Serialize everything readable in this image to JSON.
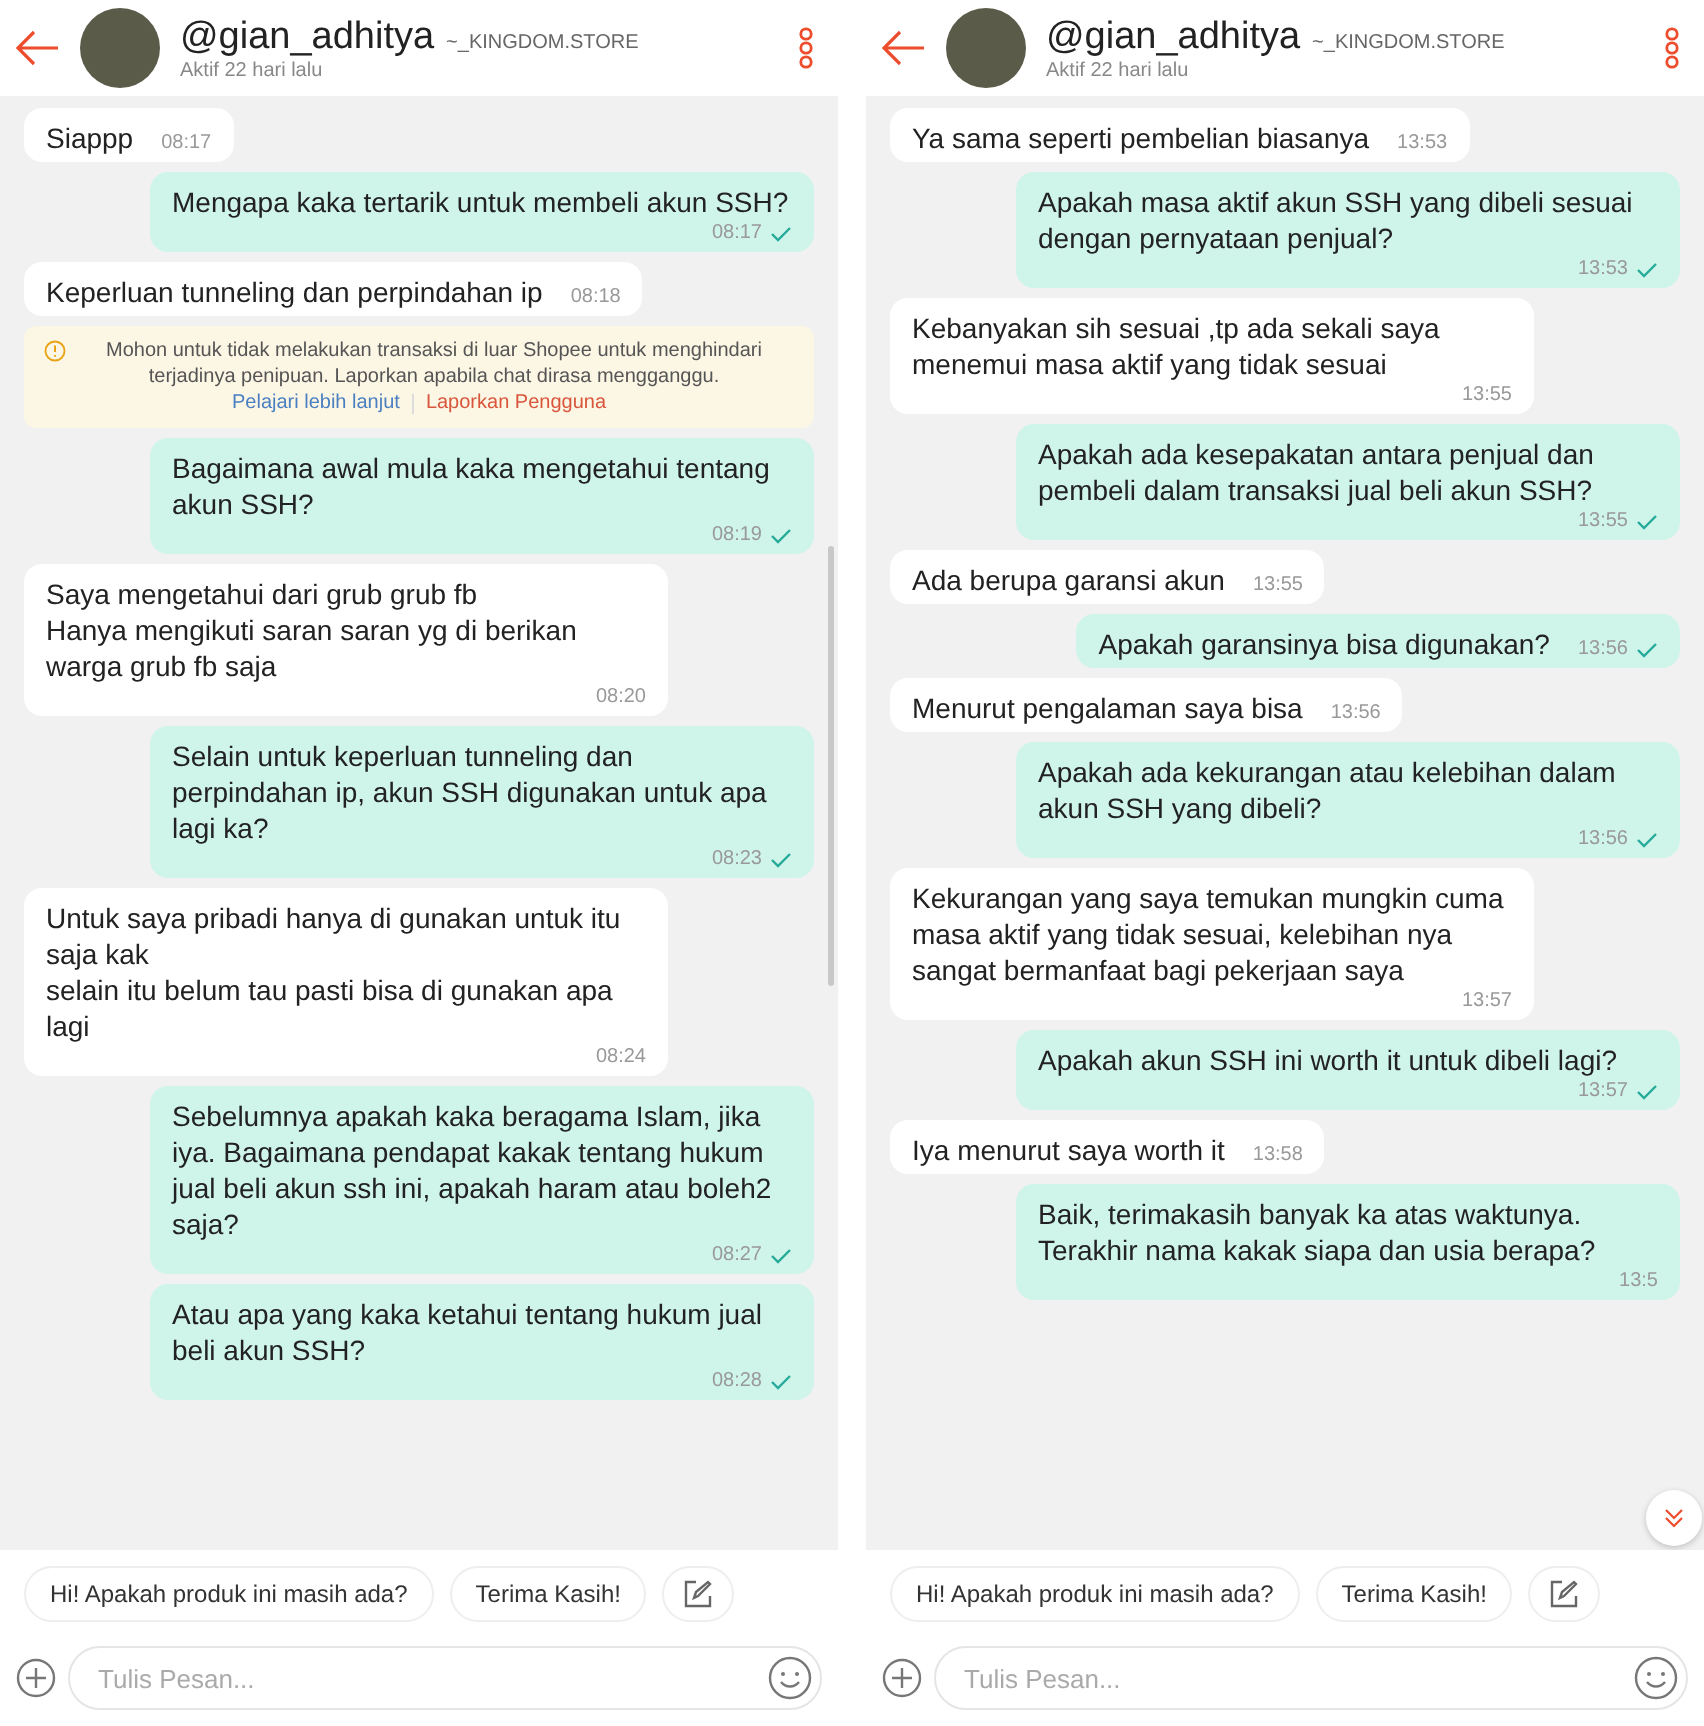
{
  "panels": [
    {
      "header": {
        "name": "@gian_adhitya",
        "shop": "~_KINGDOM.STORE",
        "status": "Aktif 22 hari lalu"
      },
      "show_scrollbar": true,
      "show_scroll_button": false,
      "messages": [
        {
          "kind": "message",
          "outgoing": false,
          "text": "Siappp",
          "time": "08:17",
          "read": false
        },
        {
          "kind": "message",
          "outgoing": true,
          "text": "Mengapa kaka tertarik untuk membeli akun SSH?",
          "time": "08:17",
          "read": true
        },
        {
          "kind": "message",
          "outgoing": false,
          "text": "Keperluan tunneling dan perpindahan ip",
          "time": "08:18",
          "read": false
        },
        {
          "kind": "notice",
          "text": "Mohon untuk tidak melakukan transaksi di luar Shopee untuk menghindari terjadinya penipuan. Laporkan apabila chat dirasa mengganggu.",
          "links": [
            {
              "label": "Pelajari lebih lanjut",
              "color": "#4a7fc1"
            },
            {
              "label": "Laporkan Pengguna",
              "color": "#d9553b"
            }
          ]
        },
        {
          "kind": "message",
          "outgoing": true,
          "text": "Bagaimana awal mula kaka mengetahui tentang akun SSH?",
          "time": "08:19",
          "read": true
        },
        {
          "kind": "message",
          "outgoing": false,
          "text": "Saya mengetahui dari grub grub fb\nHanya mengikuti saran saran yg di berikan warga grub fb saja",
          "time": "08:20",
          "read": false
        },
        {
          "kind": "message",
          "outgoing": true,
          "text": "Selain untuk keperluan tunneling dan perpindahan ip, akun SSH digunakan untuk apa lagi ka?",
          "time": "08:23",
          "read": true
        },
        {
          "kind": "message",
          "outgoing": false,
          "text": "Untuk saya pribadi hanya di gunakan untuk itu saja kak\nselain itu belum tau pasti bisa di gunakan apa lagi",
          "time": "08:24",
          "read": false
        },
        {
          "kind": "message",
          "outgoing": true,
          "text": "Sebelumnya apakah kaka beragama Islam, jika iya. Bagaimana pendapat kakak tentang hukum jual beli akun ssh ini, apakah haram atau boleh2 saja?",
          "time": "08:27",
          "read": true
        },
        {
          "kind": "message",
          "outgoing": true,
          "text": "Atau apa yang kaka ketahui tentang hukum jual beli akun SSH?",
          "time": "08:28",
          "read": true
        }
      ],
      "quick_replies": [
        "Hi! Apakah produk ini masih ada?",
        "Terima Kasih!"
      ],
      "input": {
        "placeholder": "Tulis Pesan..."
      }
    },
    {
      "header": {
        "name": "@gian_adhitya",
        "shop": "~_KINGDOM.STORE",
        "status": "Aktif 22 hari lalu"
      },
      "show_scrollbar": false,
      "show_scroll_button": true,
      "messages": [
        {
          "kind": "message",
          "outgoing": false,
          "text": "Ya sama seperti pembelian biasanya",
          "time": "13:53",
          "read": false
        },
        {
          "kind": "message",
          "outgoing": true,
          "text": "Apakah masa aktif akun SSH yang dibeli sesuai dengan pernyataan penjual?",
          "time": "13:53",
          "read": true
        },
        {
          "kind": "message",
          "outgoing": false,
          "text": "Kebanyakan sih sesuai ,tp ada sekali saya menemui masa aktif yang tidak sesuai",
          "time": "13:55",
          "read": false
        },
        {
          "kind": "message",
          "outgoing": true,
          "text": "Apakah ada kesepakatan antara penjual dan pembeli dalam transaksi jual beli akun SSH?",
          "time": "13:55",
          "read": true
        },
        {
          "kind": "message",
          "outgoing": false,
          "text": "Ada berupa garansi akun",
          "time": "13:55",
          "read": false
        },
        {
          "kind": "message",
          "outgoing": true,
          "text": "Apakah garansinya bisa digunakan?",
          "time": "13:56",
          "read": true
        },
        {
          "kind": "message",
          "outgoing": false,
          "text": "Menurut pengalaman saya bisa",
          "time": "13:56",
          "read": false
        },
        {
          "kind": "message",
          "outgoing": true,
          "text": "Apakah ada kekurangan atau kelebihan dalam akun SSH yang dibeli?",
          "time": "13:56",
          "read": true
        },
        {
          "kind": "message",
          "outgoing": false,
          "text": "Kekurangan yang saya temukan mungkin cuma masa aktif yang tidak sesuai, kelebihan nya sangat bermanfaat bagi pekerjaan saya",
          "time": "13:57",
          "read": false
        },
        {
          "kind": "message",
          "outgoing": true,
          "text": "Apakah akun SSH ini worth it untuk dibeli lagi?",
          "time": "13:57",
          "read": true
        },
        {
          "kind": "message",
          "outgoing": false,
          "text": "Iya menurut saya worth it",
          "time": "13:58",
          "read": false
        },
        {
          "kind": "message",
          "outgoing": true,
          "text": "Baik, terimakasih banyak ka atas waktunya.\nTerakhir nama kakak siapa dan usia berapa?",
          "time": "13:5",
          "read": false
        }
      ],
      "quick_replies": [
        "Hi! Apakah produk ini masih ada?",
        "Terima Kasih!"
      ],
      "input": {
        "placeholder": "Tulis Pesan..."
      }
    }
  ]
}
